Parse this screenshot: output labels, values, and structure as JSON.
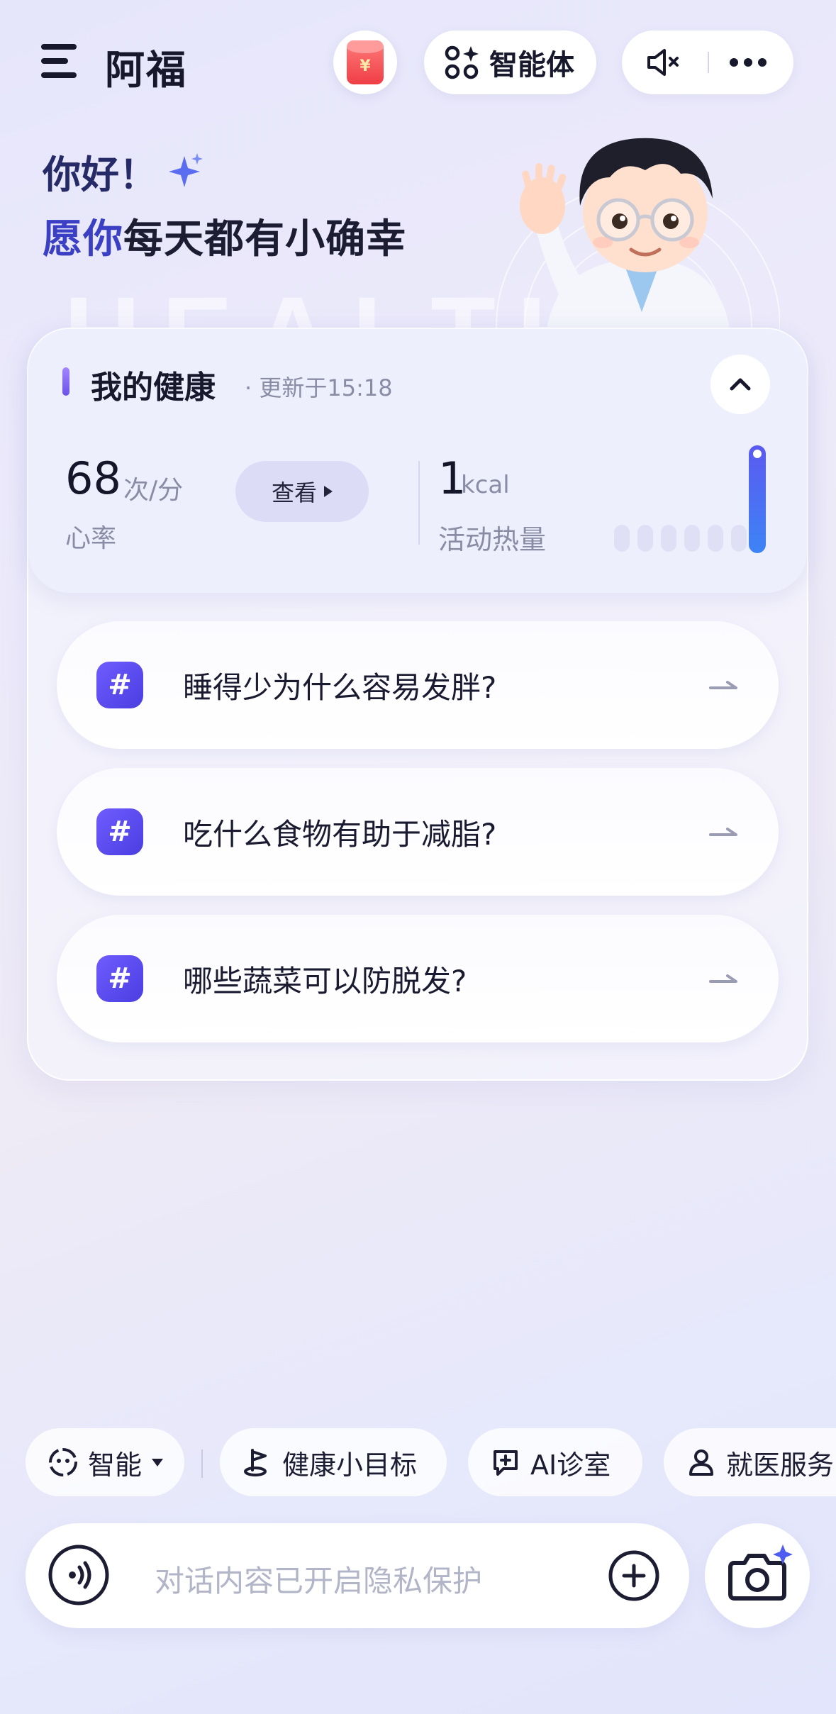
{
  "header": {
    "app_title": "阿福",
    "agent_label": "智能体",
    "icons": [
      "menu-icon",
      "red-packet-icon",
      "apps-sparkle-icon",
      "speaker-muted-icon",
      "more-icon"
    ],
    "red_packet_symbol": "¥"
  },
  "greeting": {
    "line1": "你好！",
    "line2_highlight": "愿你",
    "line2_rest": "每天都有小确幸",
    "background_word": "HEALTH"
  },
  "health_card": {
    "title": "我的健康",
    "updated": "· 更新于15:18",
    "heart_rate": {
      "value": "68",
      "unit": "次/分",
      "label": "心率"
    },
    "view_button": "查看",
    "calories": {
      "value": "1",
      "unit": "kcal",
      "label": "活动热量"
    },
    "accent": "#5b59f0"
  },
  "suggestions": [
    {
      "text": "睡得少为什么容易发胖?"
    },
    {
      "text": "吃什么食物有助于减脂?"
    },
    {
      "text": "哪些蔬菜可以防脱发?"
    }
  ],
  "chips": {
    "mode": "智能",
    "goal": "健康小目标",
    "clinic": "AI诊室",
    "service": "就医服务"
  },
  "input": {
    "placeholder": "对话内容已开启隐私保护"
  }
}
